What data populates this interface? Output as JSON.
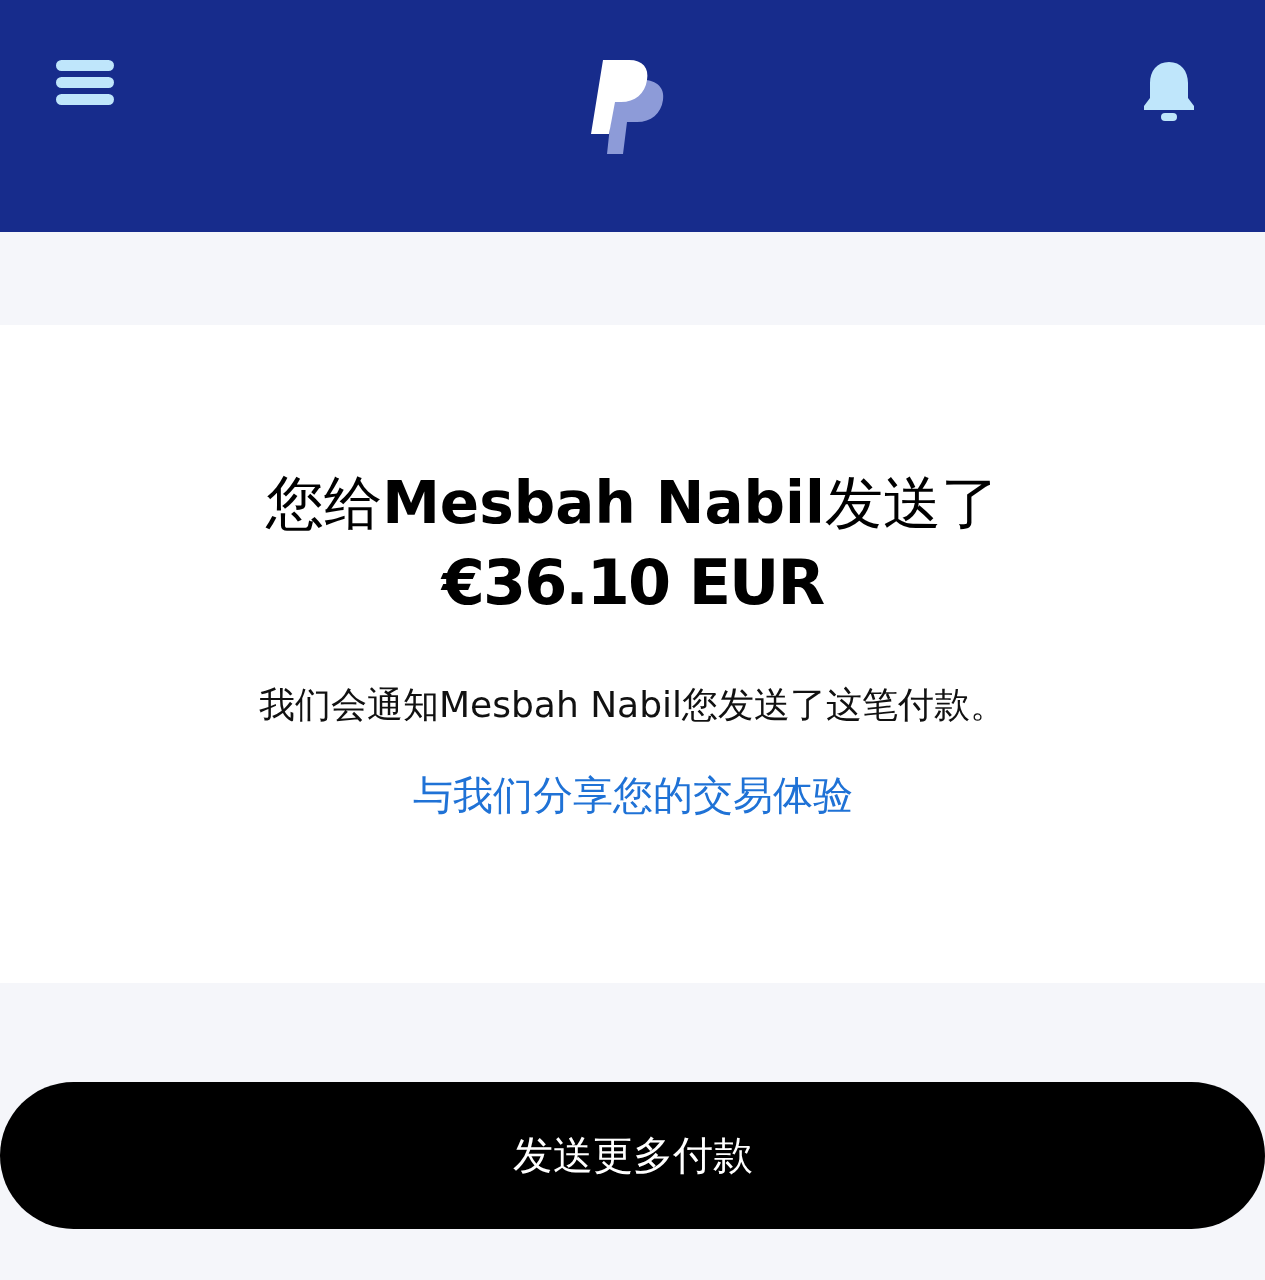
{
  "confirmation": {
    "title": "您给**Mesbah Nabil**发送了",
    "amount": "€36.10 EUR",
    "message": "我们会通知Mesbah Nabil您发送了这笔付款。",
    "feedback_link": "与我们分享您的交易体验"
  },
  "primary_button": "发送更多付款"
}
